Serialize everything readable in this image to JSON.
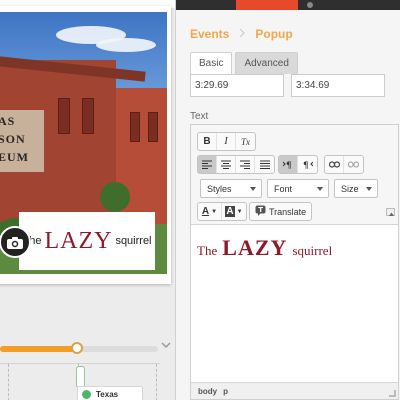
{
  "preview": {
    "sign_lines": [
      "AS",
      "SON",
      "EUM"
    ],
    "caption": {
      "prefix": "The",
      "highlight": "LAZY",
      "suffix": "squirrel"
    }
  },
  "timeline": {
    "progress_fraction": 0.49,
    "event_chip_label": "Texas"
  },
  "breadcrumb": {
    "parent": "Events",
    "current": "Popup"
  },
  "tabs": [
    {
      "label": "Basic",
      "selected": true
    },
    {
      "label": "Advanced",
      "selected": false
    }
  ],
  "times": {
    "start": "3:29.69",
    "end": "3:34.69"
  },
  "text_field": {
    "label": "Text"
  },
  "toolbar": {
    "bold": "B",
    "italic": "I",
    "clear_format": "Tx",
    "styles": "Styles",
    "font": "Font",
    "size": "Size",
    "text_color": "A",
    "bg_color": "A",
    "translate": "Translate"
  },
  "editor_content": {
    "prefix": "The",
    "highlight": "LAZY",
    "suffix": "squirrel"
  },
  "status_path": [
    "body",
    "p"
  ],
  "colors": {
    "accent_orange": "#f39c28",
    "caption_red": "#8b1a2b",
    "topbar_active": "#e64a2a"
  }
}
